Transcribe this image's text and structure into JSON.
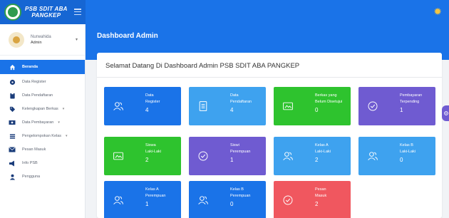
{
  "brand": {
    "line1": "PSB SDIT ABA",
    "line2": "PANGKEP"
  },
  "user": {
    "name": "Nurwahida",
    "role": "Admin"
  },
  "menu": [
    {
      "label": "Beranda",
      "icon": "home-icon",
      "active": true
    },
    {
      "label": "Data Register",
      "icon": "disc-icon"
    },
    {
      "label": "Data Pendaftaran",
      "icon": "clipboard-icon"
    },
    {
      "label": "Kelengkapan Berkas",
      "icon": "tags-icon",
      "caret": "▾"
    },
    {
      "label": "Data Pembayaran",
      "icon": "money-icon",
      "caret": "▾"
    },
    {
      "label": "Pengelompokan Kelas",
      "icon": "list-icon",
      "caret": "▾"
    },
    {
      "label": "Pesan Masuk",
      "icon": "envelope-icon"
    },
    {
      "label": "Info PSB",
      "icon": "megaphone-icon"
    },
    {
      "label": "Pengguna",
      "icon": "user-icon"
    }
  ],
  "header": {
    "title": "Dashboard Admin"
  },
  "welcome": "Selamat Datang Di Dashboard Admin PSB SDIT ABA PANGKEP",
  "tiles": [
    {
      "line1": "Data",
      "line2": "Register",
      "value": "4",
      "color": "#1a73e8",
      "icon": "users-icon"
    },
    {
      "line1": "Data",
      "line2": "Pendaftaran",
      "value": "4",
      "color": "#3ea2ef",
      "icon": "document-icon"
    },
    {
      "line1": "Berkas yang",
      "line2": "Belum Disetujui",
      "value": "0",
      "color": "#2ec32e",
      "icon": "folder-icon"
    },
    {
      "line1": "Pembayaran",
      "line2": "Terpending",
      "value": "1",
      "color": "#6f5bd1",
      "icon": "check-circle-icon"
    },
    {
      "line1": "Siswa",
      "line2": "Laki-Laki",
      "value": "2",
      "color": "#2ec32e",
      "icon": "folder-icon"
    },
    {
      "line1": "Siswi",
      "line2": "Perempuan",
      "value": "1",
      "color": "#6f5bd1",
      "icon": "check-circle-icon"
    },
    {
      "line1": "Kelas A",
      "line2": "Laki-Laki",
      "value": "2",
      "color": "#3ea2ef",
      "icon": "users-icon"
    },
    {
      "line1": "Kelas B",
      "line2": "Laki-Laki",
      "value": "0",
      "color": "#3ea2ef",
      "icon": "users-icon"
    },
    {
      "line1": "Kelas A",
      "line2": "Perempuan",
      "value": "1",
      "color": "#1a73e8",
      "icon": "users-icon"
    },
    {
      "line1": "Kelas B",
      "line2": "Perempuan",
      "value": "0",
      "color": "#1a73e8",
      "icon": "users-icon"
    },
    {
      "line1": "Pesan",
      "line2": "Masuk",
      "value": "2",
      "color": "#f0575f",
      "icon": "check-circle-icon"
    }
  ]
}
